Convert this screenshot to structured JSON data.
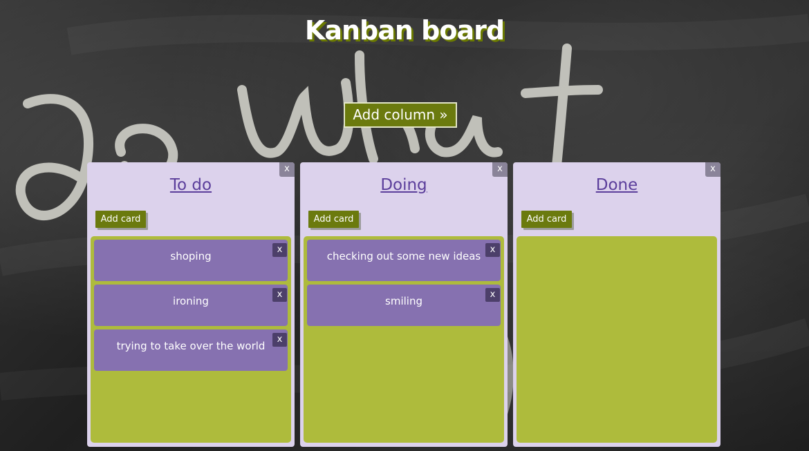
{
  "board": {
    "title": "Kanban board",
    "add_column_label": "Add column  »"
  },
  "columns": [
    {
      "title": "To do",
      "close_label": "x",
      "add_card_label": "Add card",
      "cards": [
        {
          "text": "shoping",
          "close_label": "x"
        },
        {
          "text": "ironing",
          "close_label": "x"
        },
        {
          "text": "trying to take over the world",
          "close_label": "x"
        }
      ]
    },
    {
      "title": "Doing",
      "close_label": "x",
      "add_card_label": "Add card",
      "cards": [
        {
          "text": "checking out some new ideas",
          "close_label": "x"
        },
        {
          "text": "smiling",
          "close_label": "x"
        }
      ]
    },
    {
      "title": "Done",
      "close_label": "x",
      "add_card_label": "Add card",
      "cards": []
    }
  ],
  "colors": {
    "column_bg": "#dcd2ec",
    "card_list_bg": "#aebb3c",
    "card_bg": "#8671b0",
    "button_bg": "#6b7a0e",
    "title_color": "#5b3e9b"
  },
  "background": {
    "chalk_text": "Do what"
  }
}
